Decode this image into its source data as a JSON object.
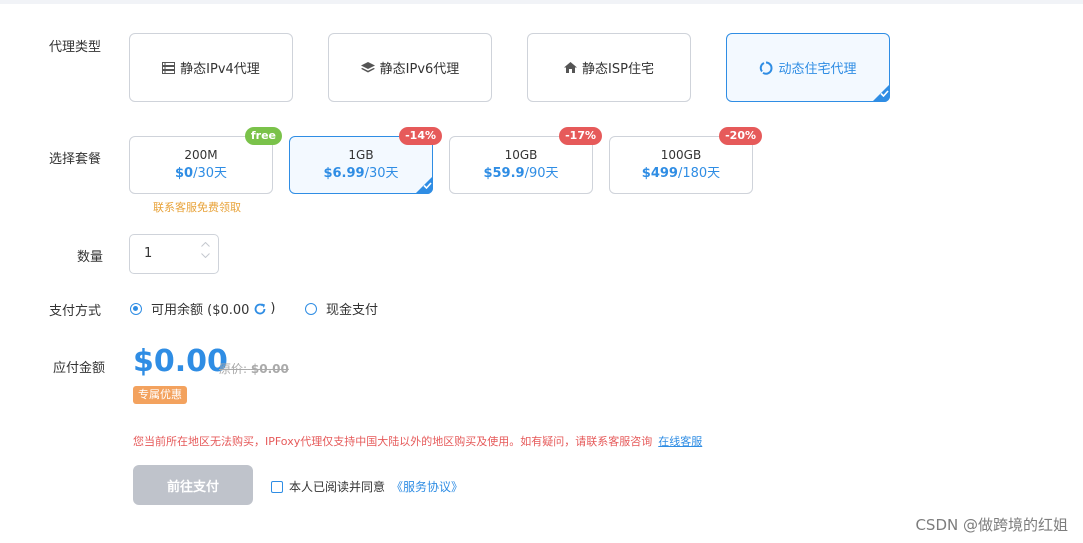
{
  "labels": {
    "proxy_type": "代理类型",
    "package": "选择套餐",
    "quantity": "数量",
    "payment": "支付方式",
    "amount_due": "应付金额"
  },
  "proxy_types": [
    {
      "label": "静态IPv4代理",
      "icon": "server-icon"
    },
    {
      "label": "静态IPv6代理",
      "icon": "layers-icon"
    },
    {
      "label": "静态ISP住宅",
      "icon": "home-icon"
    },
    {
      "label": "动态住宅代理",
      "icon": "cycle-icon",
      "selected": true
    }
  ],
  "packages": [
    {
      "size": "200M",
      "price": "$0",
      "period": "/30天",
      "badge": "free"
    },
    {
      "size": "1GB",
      "price": "$6.99",
      "period": "/30天",
      "badge": "-14%",
      "selected": true
    },
    {
      "size": "10GB",
      "price": "$59.9",
      "period": "/90天",
      "badge": "-17%"
    },
    {
      "size": "100GB",
      "price": "$499",
      "period": "/180天",
      "badge": "-20%"
    }
  ],
  "package_hint": "联系客服免费领取",
  "quantity_value": "1",
  "payment": {
    "balance_label": "可用余额 ($0.00",
    "balance_suffix": ")",
    "cash_label": "现金支付"
  },
  "amount": {
    "value": "$0.00",
    "original_prefix": "原价:",
    "original_value": "$0.00",
    "tag": "专属优惠"
  },
  "warning": {
    "text": "您当前所在地区无法购买，IPFoxy代理仅支持中国大陆以外的地区购买及使用。如有疑问，请联系客服咨询",
    "link": "在线客服"
  },
  "pay_button": "前往支付",
  "agree": {
    "text": "本人已阅读并同意",
    "link": "《服务协议》"
  },
  "watermark": "CSDN @做跨境的红姐",
  "colors": {
    "accent": "#2f8de4",
    "discount": "#e65a5a",
    "free": "#7ac24a",
    "warning": "#e65a5a",
    "tag": "#f3a25e"
  }
}
